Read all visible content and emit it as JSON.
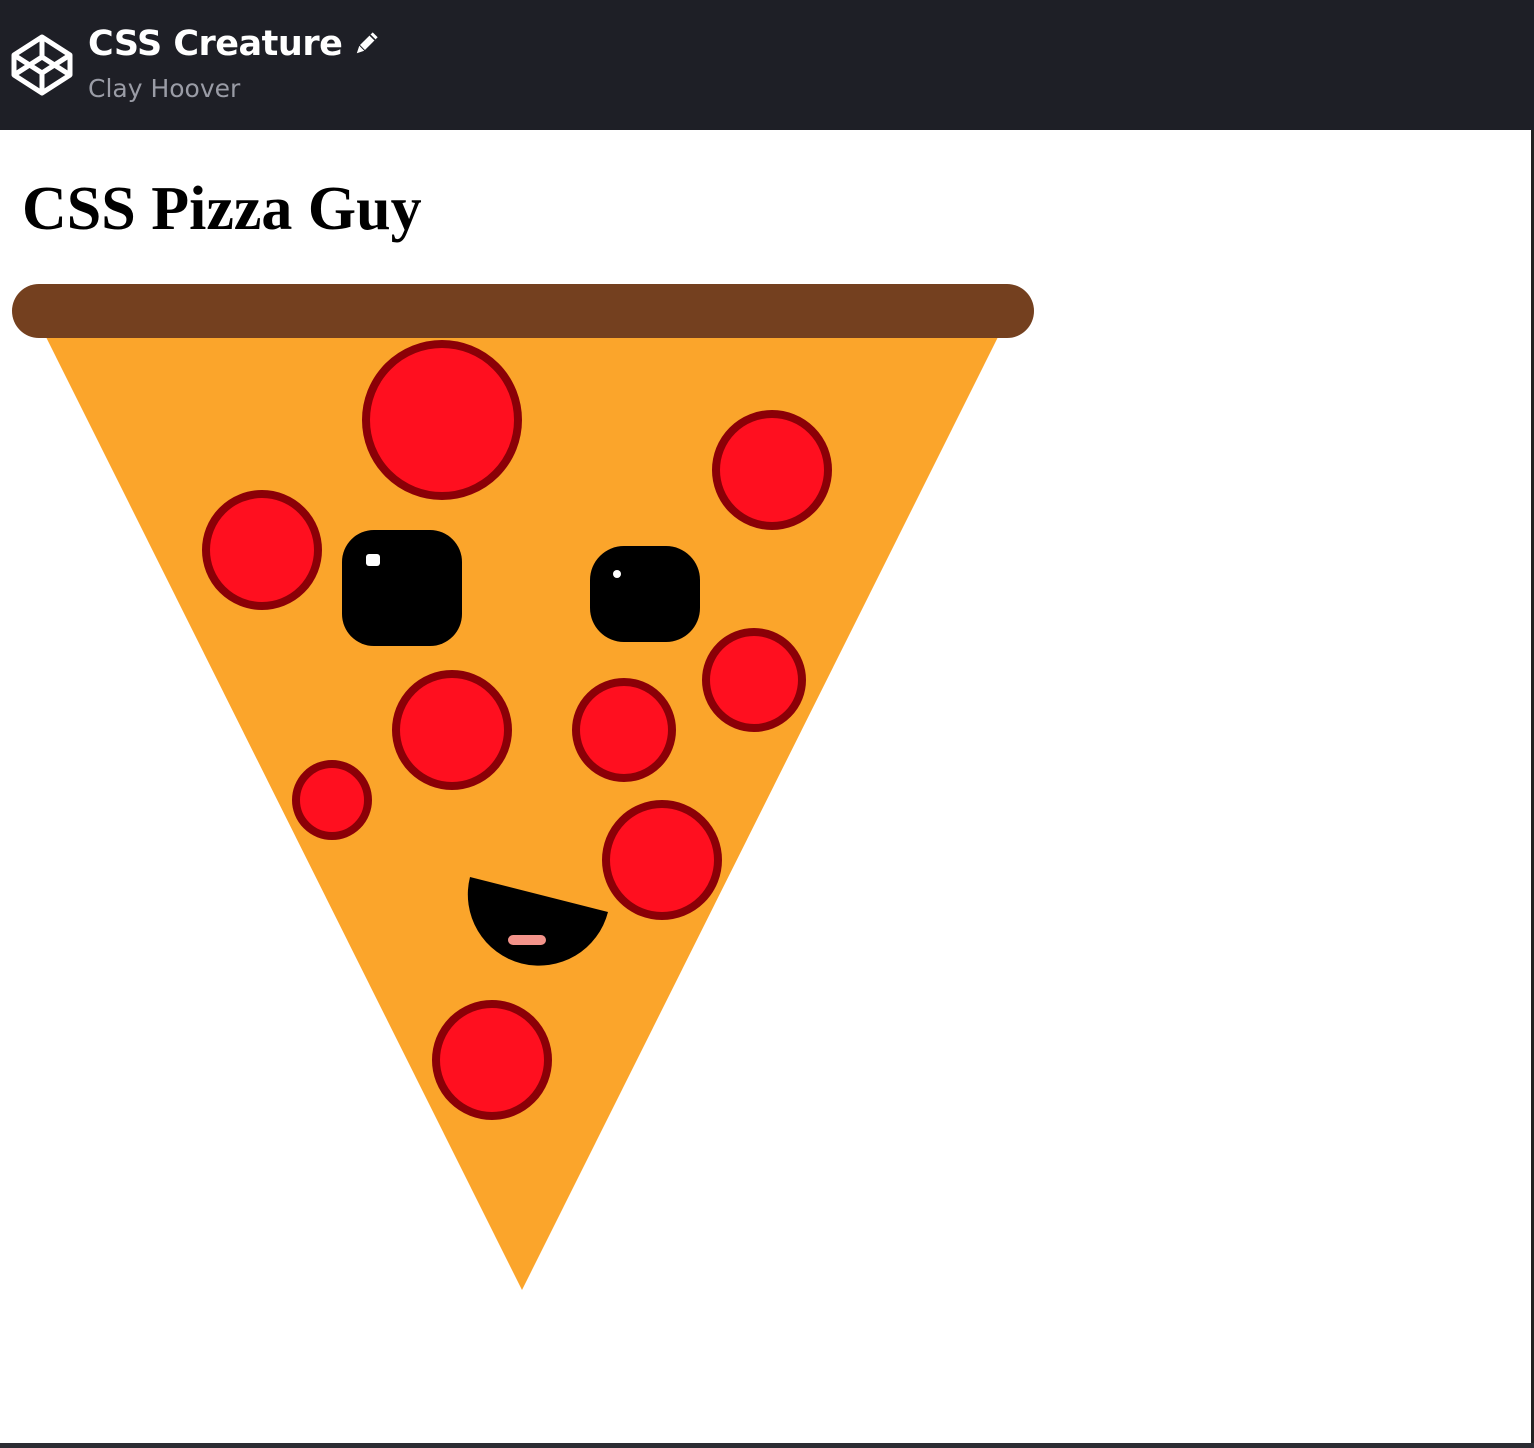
{
  "header": {
    "title": "CSS Creature",
    "author": "Clay Hoover",
    "logo_icon": "codepen-cube-icon",
    "edit_icon": "pencil-icon",
    "background": "#1e1f26"
  },
  "main": {
    "heading": "CSS Pizza Guy"
  },
  "colors": {
    "crust": "#74401f",
    "cheese": "#fba52b",
    "pepperoni": "#ff0f1f",
    "pepperoni_border": "#8b0007",
    "eye": "#000000",
    "mouth": "#000000",
    "tongue": "#f3938a"
  }
}
